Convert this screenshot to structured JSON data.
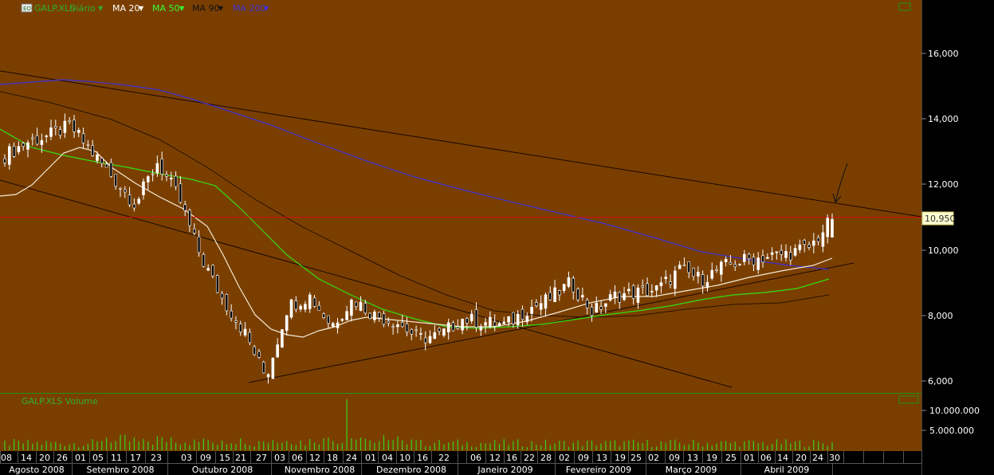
{
  "legend": {
    "symbol": "GALP.XLS",
    "symbol_suffix": "Diário",
    "ma": [
      {
        "label": "MA 20",
        "color": "#ffffff"
      },
      {
        "label": "MA 50",
        "color": "#33ff33"
      },
      {
        "label": "MA 90",
        "color": "#1a1a1a"
      },
      {
        "label": "MA 200",
        "color": "#3b2fd6"
      }
    ]
  },
  "volume_label": "GALP.XLS Volume",
  "price_badge": "10,950",
  "colors": {
    "background": "#7a3f00",
    "price_line": "#cc1010",
    "ma20": "#f4ead6",
    "ma50": "#33dd11",
    "ma90": "#2a1200",
    "ma200": "#3b2fd6",
    "trend": "#1a0800"
  },
  "chart_data": {
    "type": "candlestick",
    "title": "GALP.XLS Diário",
    "y_ticks": [
      "6,000",
      "8,000",
      "10,000",
      "12,000",
      "14,000",
      "16,000"
    ],
    "y_range": [
      5.6,
      17.5
    ],
    "volume_ticks": [
      "5.000.000",
      "10.000.000"
    ],
    "x_day_labels": [
      "08",
      "14",
      "20",
      "26",
      "01",
      "05",
      "11",
      "17",
      "23",
      "03",
      "09",
      "15",
      "21",
      "27",
      "03",
      "06",
      "12",
      "18",
      "24",
      "01",
      "04",
      "10",
      "16",
      "22",
      "06",
      "12",
      "16",
      "22",
      "28",
      "02",
      "09",
      "13",
      "19",
      "25",
      "02",
      "09",
      "13",
      "19",
      "25",
      "01",
      "06",
      "14",
      "20",
      "24",
      "30"
    ],
    "x_month_labels": [
      "Agosto 2008",
      "Setembro 2008",
      "Outubro 2008",
      "Novembro 2008",
      "Dezembro 2008",
      "Janeiro 2009",
      "Fevereiro 2009",
      "Março 2009",
      "Abril 2009"
    ],
    "last_close": 10.95,
    "price_series": [
      {
        "t": "2008-08-04",
        "close": 12.9
      },
      {
        "t": "2008-08-11",
        "close": 13.3
      },
      {
        "t": "2008-08-18",
        "close": 13.5
      },
      {
        "t": "2008-08-25",
        "close": 13.8
      },
      {
        "t": "2008-09-01",
        "close": 13.0
      },
      {
        "t": "2008-09-08",
        "close": 12.2
      },
      {
        "t": "2008-09-15",
        "close": 11.4
      },
      {
        "t": "2008-09-22",
        "close": 12.7
      },
      {
        "t": "2008-09-29",
        "close": 11.6
      },
      {
        "t": "2008-10-06",
        "close": 9.8
      },
      {
        "t": "2008-10-13",
        "close": 8.5
      },
      {
        "t": "2008-10-20",
        "close": 7.5
      },
      {
        "t": "2008-10-27",
        "close": 6.1
      },
      {
        "t": "2008-11-03",
        "close": 8.3
      },
      {
        "t": "2008-11-10",
        "close": 8.6
      },
      {
        "t": "2008-11-17",
        "close": 7.7
      },
      {
        "t": "2008-11-24",
        "close": 8.5
      },
      {
        "t": "2008-12-01",
        "close": 8.0
      },
      {
        "t": "2008-12-08",
        "close": 7.8
      },
      {
        "t": "2008-12-15",
        "close": 7.3
      },
      {
        "t": "2008-12-22",
        "close": 7.4
      },
      {
        "t": "2009-01-05",
        "close": 7.9
      },
      {
        "t": "2009-01-12",
        "close": 7.8
      },
      {
        "t": "2009-01-19",
        "close": 7.7
      },
      {
        "t": "2009-01-26",
        "close": 8.2
      },
      {
        "t": "2009-02-02",
        "close": 8.5
      },
      {
        "t": "2009-02-09",
        "close": 9.0
      },
      {
        "t": "2009-02-16",
        "close": 8.1
      },
      {
        "t": "2009-02-23",
        "close": 8.6
      },
      {
        "t": "2009-03-02",
        "close": 8.7
      },
      {
        "t": "2009-03-09",
        "close": 8.8
      },
      {
        "t": "2009-03-16",
        "close": 9.4
      },
      {
        "t": "2009-03-23",
        "close": 9.1
      },
      {
        "t": "2009-03-30",
        "close": 9.5
      },
      {
        "t": "2009-04-06",
        "close": 9.7
      },
      {
        "t": "2009-04-13",
        "close": 9.8
      },
      {
        "t": "2009-04-20",
        "close": 9.9
      },
      {
        "t": "2009-04-27",
        "close": 10.1
      },
      {
        "t": "2009-04-30",
        "close": 10.95
      }
    ]
  }
}
